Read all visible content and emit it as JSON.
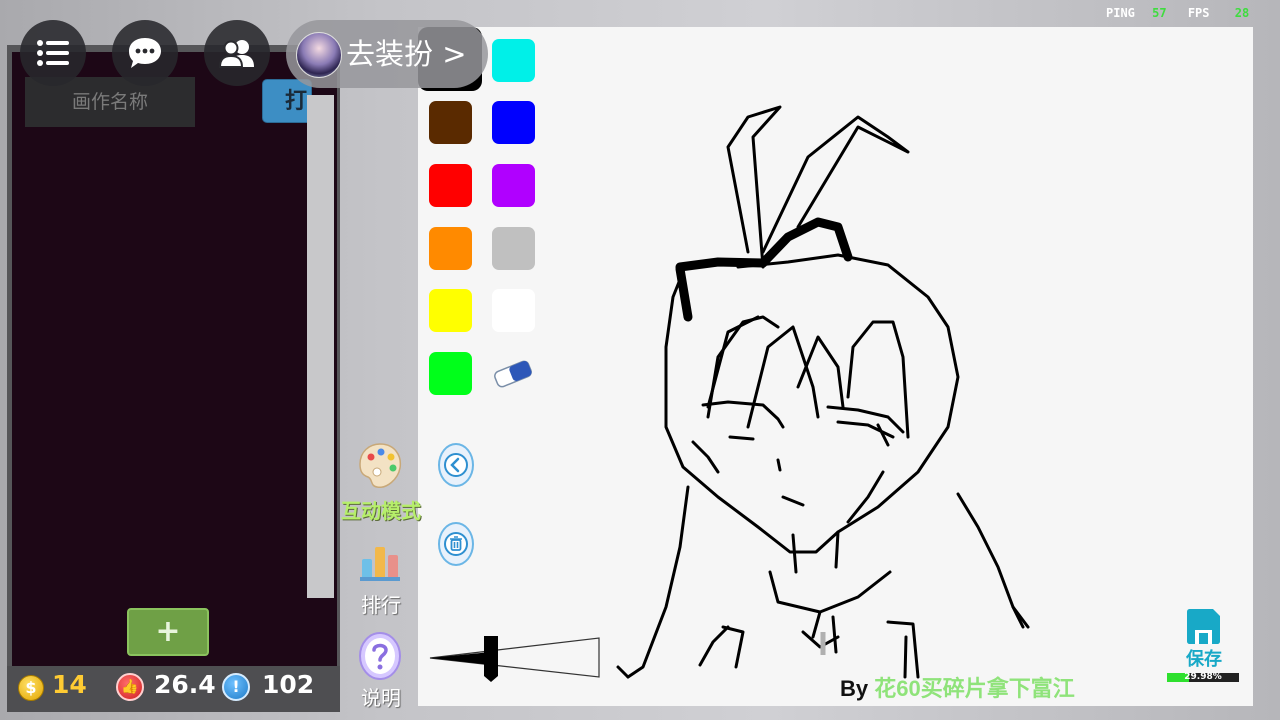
{
  "hud": {
    "ping_label": "PING",
    "ping_value": "57",
    "fps_label": "FPS",
    "fps_value": "28"
  },
  "top_bar": {
    "dress_up_label": "去装扮 >"
  },
  "gallery": {
    "name_placeholder": "画作名称",
    "print_button_label": "打",
    "add_button_label": "+"
  },
  "stats": {
    "coins": "14",
    "likes": "26.4",
    "alerts": "102"
  },
  "palette": {
    "selected_color": "#000000",
    "colors": [
      "#000000",
      "#00f0e8",
      "#5a2a00",
      "#0000ff",
      "#ff0000",
      "#b000ff",
      "#ff8a00",
      "#c0c0c0",
      "#ffff00",
      "#ffffff",
      "#00ff1a"
    ]
  },
  "side_menu": {
    "interactive_mode": "互动模式",
    "ranking": "排行",
    "help": "说明"
  },
  "canvas": {
    "signature_prefix": "By",
    "signature_name": "花60买碎片拿下富江"
  },
  "save": {
    "label": "保存",
    "progress_text": "29.98%",
    "progress_fraction": 0.2998
  },
  "colors": {
    "accent_blue": "#18a9c7",
    "progress_green": "#2ee02e",
    "interactive_green": "#b6ef6a",
    "coin_gold": "#ffcb33"
  }
}
